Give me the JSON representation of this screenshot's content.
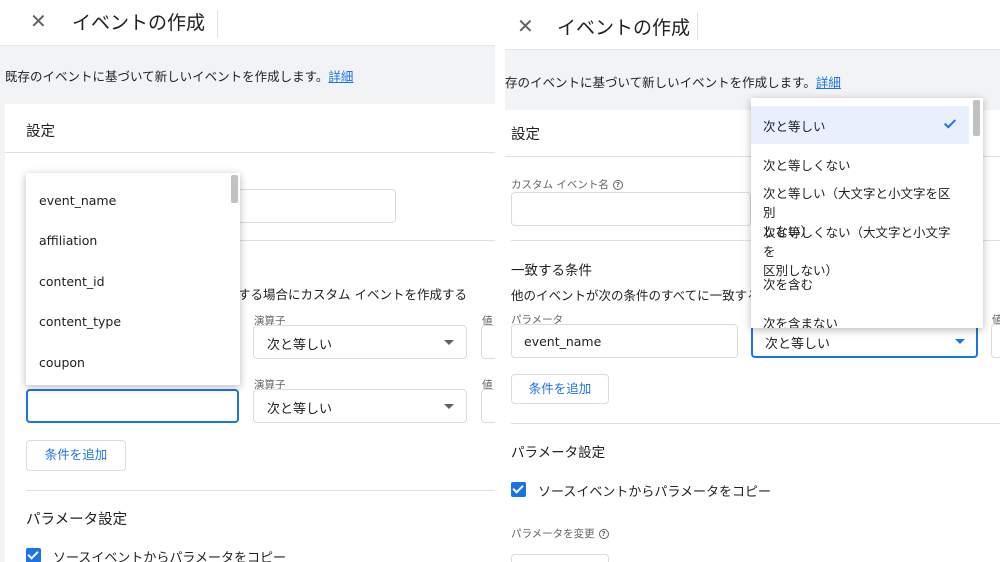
{
  "left_pane": {
    "header": {
      "title": "イベントの作成"
    },
    "info": {
      "text": "既存のイベントに基づいて新しいイベントを作成します。",
      "link": "詳細"
    },
    "settings_title": "設定",
    "condition_text": "する場合にカスタム イベントを作成する",
    "operator_label": "演算子",
    "value_label": "値",
    "row1_operator": "次と等しい",
    "row2_operator": "次と等しい",
    "add_condition": "条件を追加",
    "param_settings_title": "パラメータ設定",
    "copy_params_label": "ソースイベントからパラメータをコピー",
    "param_list": [
      "event_name",
      "affiliation",
      "content_id",
      "content_type",
      "coupon"
    ]
  },
  "right_pane": {
    "header": {
      "title": "イベントの作成"
    },
    "info": {
      "text": "存のイベントに基づいて新しいイベントを作成します。",
      "link": "詳細"
    },
    "settings_title": "設定",
    "custom_event_name_label": "カスタム イベント名",
    "match_conditions_title": "一致する条件",
    "match_conditions_desc": "他のイベントが次の条件のすべてに一致する場",
    "parameter_label": "パラメータ",
    "parameter_value": "event_name",
    "operator_value": "次と等しい",
    "value_label": "値",
    "add_condition": "条件を追加",
    "param_settings_title": "パラメータ設定",
    "copy_params_label": "ソースイベントからパラメータをコピー",
    "modify_params_label": "パラメータを変更",
    "operator_options": [
      [
        "次と等しい"
      ],
      [
        "次と等しくない"
      ],
      [
        "次と等しい（大文字と小文字を区別",
        "しない）"
      ],
      [
        "次と等しくない（大文字と小文字を",
        "区別しない）"
      ],
      [
        "次を含む"
      ],
      [
        "次を含まない"
      ]
    ]
  },
  "colors": {
    "accent": "#1a73e8",
    "selected_bg": "#e8f0fe",
    "page_bg": "#f1f3f4"
  },
  "icons": {
    "close": "close-icon",
    "check": "check-icon",
    "dropdown": "chevron-down-icon",
    "help": "help-icon"
  }
}
